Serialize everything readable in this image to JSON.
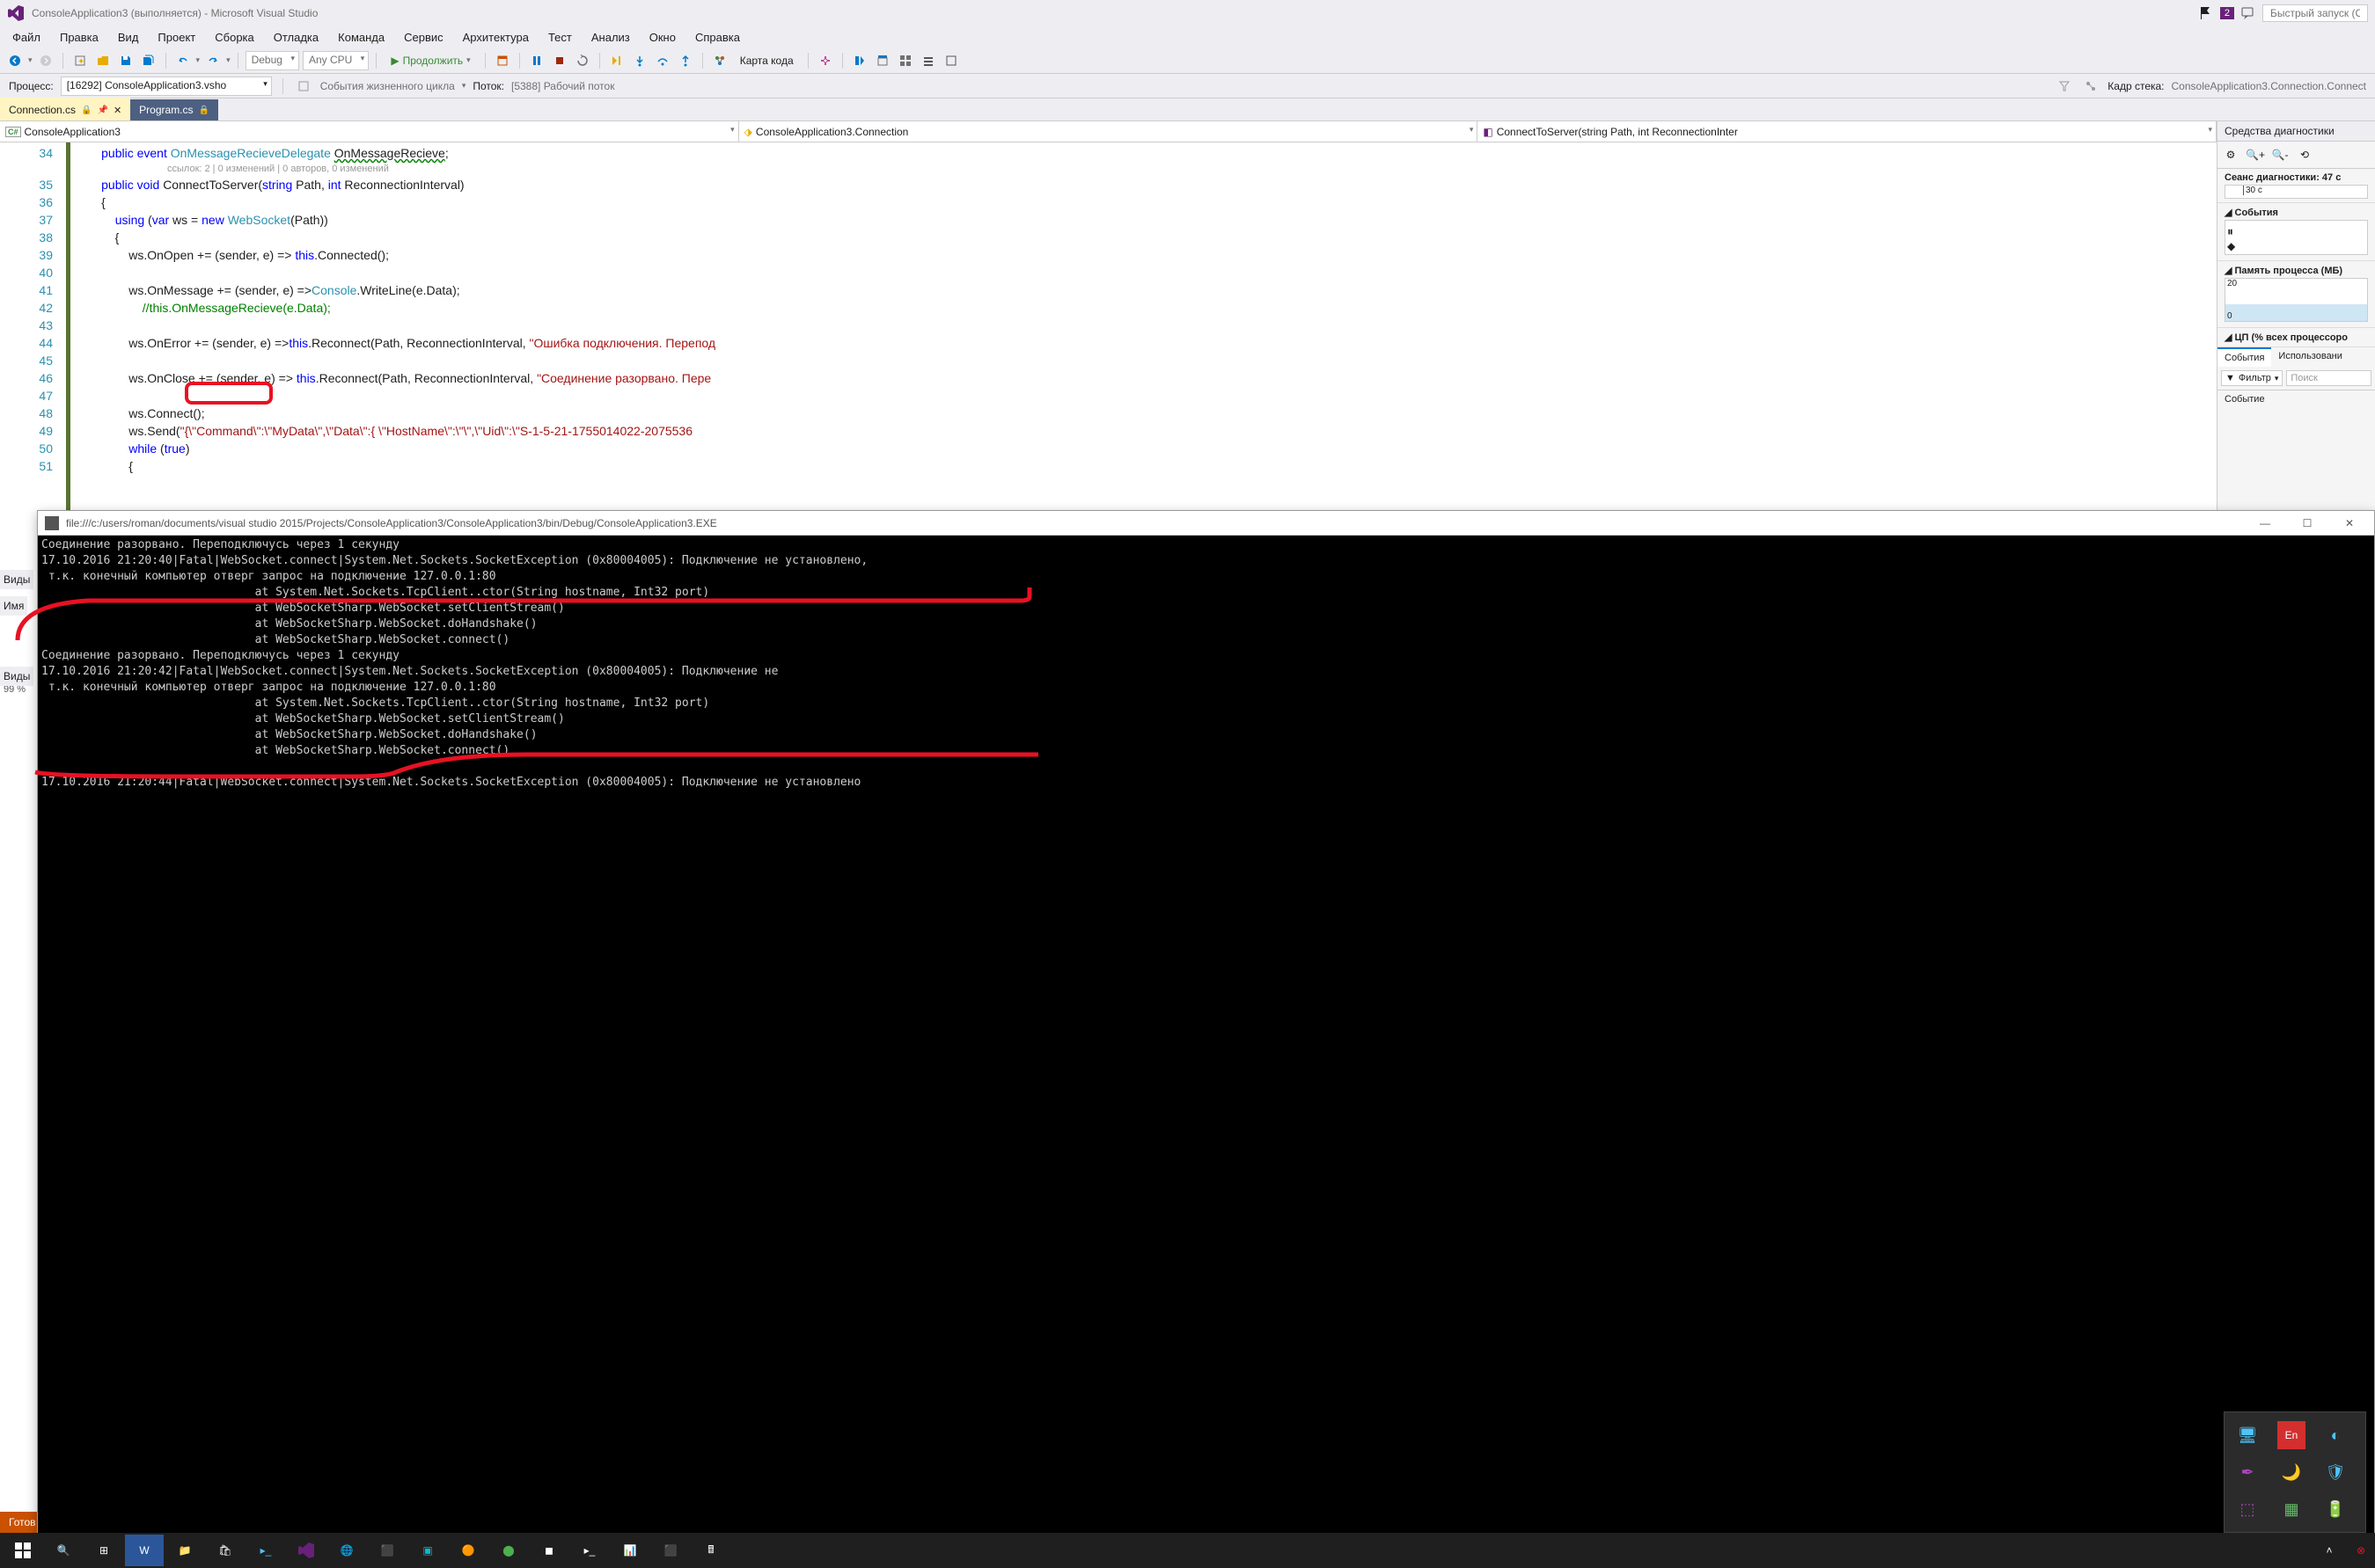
{
  "title": "ConsoleApplication3 (выполняется) - Microsoft Visual Studio",
  "quick_launch_placeholder": "Быстрый запуск (Ct",
  "notif_badge": "2",
  "menu": [
    "Файл",
    "Правка",
    "Вид",
    "Проект",
    "Сборка",
    "Отладка",
    "Команда",
    "Сервис",
    "Архитектура",
    "Тест",
    "Анализ",
    "Окно",
    "Справка"
  ],
  "toolbar": {
    "config": "Debug",
    "platform": "Any CPU",
    "continue": "Продолжить",
    "codemap": "Карта кода"
  },
  "process_bar": {
    "process_label": "Процесс:",
    "process_value": "[16292] ConsoleApplication3.vsho",
    "lifecycle": "События жизненного цикла",
    "thread_label": "Поток:",
    "thread_value": "[5388] Рабочий поток",
    "stackframe_label": "Кадр стека:",
    "stackframe_value": "ConsoleApplication3.Connection.Connect"
  },
  "tabs": {
    "active": "Connection.cs",
    "inactive": "Program.cs"
  },
  "nav": {
    "project": "ConsoleApplication3",
    "class": "ConsoleApplication3.Connection",
    "method": "ConnectToServer(string Path, int ReconnectionInter"
  },
  "codelens": "ссылок: 2 | 0 изменений | 0 авторов, 0 изменений",
  "code": {
    "l34": {
      "pre": "        ",
      "kw1": "public",
      "sp1": " ",
      "kw2": "event",
      "sp2": " ",
      "type": "OnMessageRecieveDelegate",
      "sp3": " ",
      "name": "OnMessageRecieve",
      ";": ";"
    },
    "l35": {
      "pre": "        ",
      "kw1": "public",
      "sp1": " ",
      "kw2": "void",
      "sp2": " ",
      "name": "ConnectToServer(",
      "kw3": "string",
      "sp3": " Path, ",
      "kw4": "int",
      "sp4": " ReconnectionInterval)"
    },
    "l36": "        {",
    "l37": {
      "pre": "            ",
      "kw1": "using",
      "sp1": " (",
      "kw2": "var",
      "sp2": " ws = ",
      "kw3": "new",
      "sp3": " ",
      "type": "WebSocket",
      "rest": "(Path))"
    },
    "l38": "            {",
    "l39": {
      "pre": "                ws.OnOpen += (sender, e) => ",
      "kw": "this",
      "rest": ".Connected();"
    },
    "l40": "",
    "l41": {
      "pre": "                ws.OnMessage += (sender, e) =>",
      "type": "Console",
      "rest": ".WriteLine(e.Data);"
    },
    "l42": {
      "pre": "                    ",
      "comment": "//this.OnMessageRecieve(e.Data);"
    },
    "l43": "",
    "l44": {
      "pre": "                ws.OnError += (sender, e) =>",
      "kw": "this",
      "mid": ".Reconnect(Path, ReconnectionInterval, ",
      "str": "\"Ошибка подключения. Перепод"
    },
    "l45": "",
    "l46": {
      "pre": "                ws.OnClose += (sender, e) => ",
      "kw": "this",
      "mid": ".Reconnect(Path, ReconnectionInterval, ",
      "str": "\"Соединение разорвано. Пере"
    },
    "l47": "",
    "l48": "                ws.Connect();",
    "l49": {
      "pre": "                ws.Send(",
      "str": "\"{\\\"Command\\\":\\\"MyData\\\",\\\"Data\\\":{ \\\"HostName\\\":\\\"\\\",\\\"Uid\\\":\\\"S-1-5-21-1755014022-2075536"
    },
    "l50": {
      "pre": "                ",
      "kw1": "while",
      "sp": " (",
      "kw2": "true",
      "rest": ")"
    },
    "l51": "                {"
  },
  "line_numbers": [
    "34",
    "35",
    "36",
    "37",
    "38",
    "39",
    "40",
    "41",
    "42",
    "43",
    "44",
    "45",
    "46",
    "47",
    "48",
    "49",
    "50",
    "51"
  ],
  "pct": "99 %",
  "diag": {
    "title": "Средства диагностики",
    "session": "Сеанс диагностики: 47 с",
    "time_marker": "30 с",
    "events": "События",
    "memory": "Память процесса (МБ)",
    "mem_max": "20",
    "mem_min": "0",
    "cpu": "ЦП (% всех процессоро",
    "tab_events": "События",
    "tab_usage": "Использовани",
    "filter": "Фильтр",
    "search": "Поиск",
    "event_col": "Событие"
  },
  "console": {
    "title": "file:///c:/users/roman/documents/visual studio 2015/Projects/ConsoleApplication3/ConsoleApplication3/bin/Debug/ConsoleApplication3.EXE",
    "lines": [
      "Соединение разорвано. Переподключусь через 1 секунду",
      "17.10.2016 21:20:40|Fatal|WebSocket.connect|System.Net.Sockets.SocketException (0x80004005): Подключение не установлено,",
      " т.к. конечный компьютер отверг запрос на подключение 127.0.0.1:80",
      "                               at System.Net.Sockets.TcpClient..ctor(String hostname, Int32 port)",
      "                               at WebSocketSharp.WebSocket.setClientStream()",
      "                               at WebSocketSharp.WebSocket.doHandshake()",
      "                               at WebSocketSharp.WebSocket.connect()",
      "Соединение разорвано. Переподключусь через 1 секунду",
      "17.10.2016 21:20:42|Fatal|WebSocket.connect|System.Net.Sockets.SocketException (0x80004005): Подключение не ",
      " т.к. конечный компьютер отверг запрос на подключение 127.0.0.1:80",
      "                               at System.Net.Sockets.TcpClient..ctor(String hostname, Int32 port)",
      "                               at WebSocketSharp.WebSocket.setClientStream()",
      "                               at WebSocketSharp.WebSocket.doHandshake()",
      "                               at WebSocketSharp.WebSocket.connect()",
      "",
      "17.10.2016 21:20:44|Fatal|WebSocket.connect|System.Net.Sockets.SocketException (0x80004005): Подключение не установлено"
    ]
  },
  "side_labels": {
    "views": "Виды",
    "name": "Имя",
    "views2": "Виды"
  },
  "status": "Готов",
  "tray_en": "En"
}
